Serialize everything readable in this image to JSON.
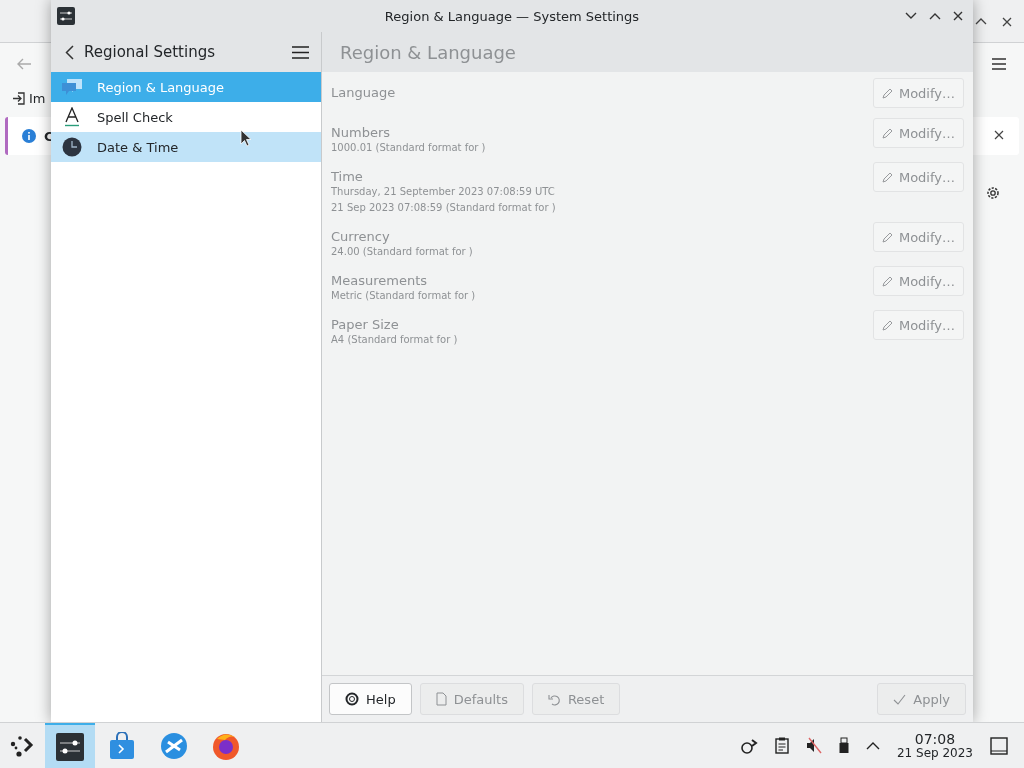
{
  "background_window": {
    "import_label": "Im",
    "notice_text": "C"
  },
  "window": {
    "title": "Region & Language — System Settings"
  },
  "sidebar": {
    "title": "Regional Settings",
    "items": [
      {
        "label": "Region & Language",
        "selected": true,
        "hovered": false
      },
      {
        "label": "Spell Check",
        "selected": false,
        "hovered": false
      },
      {
        "label": "Date & Time",
        "selected": false,
        "hovered": true
      }
    ]
  },
  "page": {
    "title": "Region & Language",
    "disabled": true,
    "settings": [
      {
        "label": "Language",
        "button": "Modify…",
        "disabled": true
      },
      {
        "label": "Numbers",
        "values": [
          "1000.01 (Standard format for )"
        ],
        "button": "Modify…",
        "disabled": true
      },
      {
        "label": "Time",
        "values": [
          "Thursday, 21 September 2023 07:08:59 UTC",
          "21 Sep 2023 07:08:59 (Standard format for )"
        ],
        "button": "Modify…",
        "disabled": true
      },
      {
        "label": "Currency",
        "values": [
          "24.00 (Standard format for )"
        ],
        "button": "Modify…",
        "disabled": true
      },
      {
        "label": "Measurements",
        "values": [
          "Metric (Standard format for )"
        ],
        "button": "Modify…",
        "disabled": true
      },
      {
        "label": "Paper Size",
        "values": [
          "A4 (Standard format for )"
        ],
        "button": "Modify…",
        "disabled": true
      }
    ]
  },
  "footer": {
    "buttons": [
      {
        "label": "Help",
        "disabled": false
      },
      {
        "label": "Defaults",
        "disabled": true
      },
      {
        "label": "Reset",
        "disabled": true
      },
      {
        "label": "Apply",
        "disabled": true
      }
    ]
  },
  "taskbar": {
    "apps": [
      {
        "selected": true
      },
      {
        "selected": false
      },
      {
        "selected": false
      },
      {
        "selected": false
      }
    ],
    "time": "07:08",
    "date": "21 Sep 2023"
  }
}
